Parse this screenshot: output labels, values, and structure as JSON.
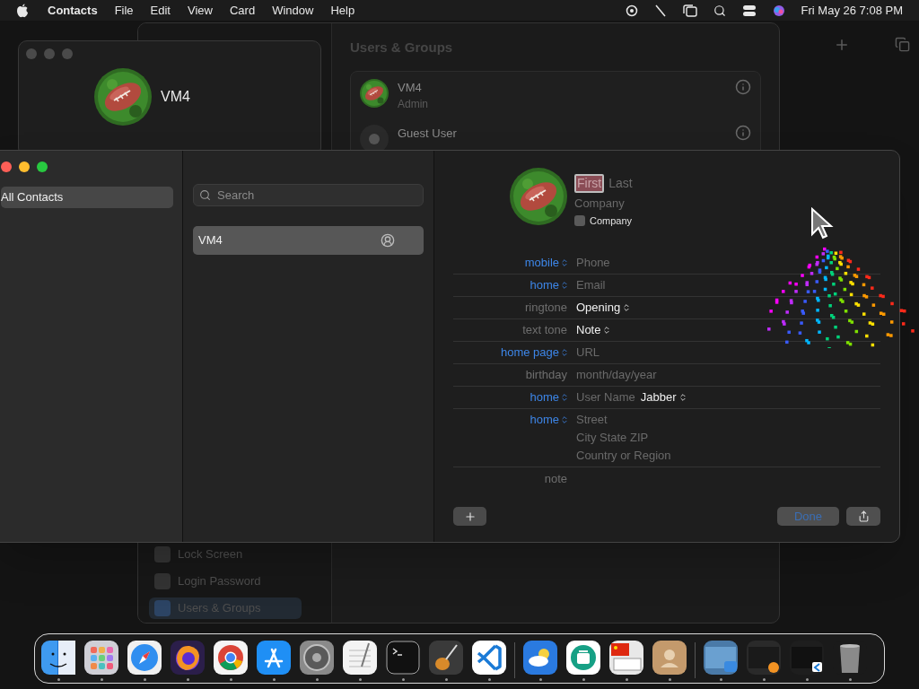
{
  "menu_bar": {
    "app_name": "Contacts",
    "menus": [
      "File",
      "Edit",
      "View",
      "Card",
      "Window",
      "Help"
    ],
    "clock": "Fri May 26 7:08 PM"
  },
  "user_window": {
    "name": "VM4"
  },
  "settings_window": {
    "title": "Users & Groups",
    "users": [
      {
        "name": "VM4",
        "role": "Admin",
        "kind": "avatar"
      },
      {
        "name": "Guest User",
        "kind": "guest"
      }
    ],
    "sidebar": [
      {
        "label": "Lock Screen",
        "selected": false
      },
      {
        "label": "Login Password",
        "selected": false
      },
      {
        "label": "Users & Groups",
        "selected": true
      }
    ]
  },
  "contacts_window": {
    "groups": [
      {
        "label": "All Contacts",
        "selected": true
      }
    ],
    "search": {
      "placeholder": "Search"
    },
    "contacts": [
      {
        "name": "VM4",
        "selected": true
      }
    ],
    "card": {
      "first": {
        "placeholder": "First",
        "selected": true
      },
      "last": {
        "placeholder": "Last"
      },
      "company": {
        "placeholder": "Company"
      },
      "company_checkbox": {
        "label": "Company",
        "checked": false
      },
      "fields": [
        {
          "label": "mobile",
          "kind": "popup",
          "values": [
            {
              "text": "Phone",
              "kind": "placeholder"
            }
          ]
        },
        {
          "label": "home",
          "kind": "popup",
          "values": [
            {
              "text": "Email",
              "kind": "placeholder"
            }
          ]
        },
        {
          "label": "ringtone",
          "kind": "plain",
          "values": [
            {
              "text": "Opening",
              "kind": "popup"
            }
          ]
        },
        {
          "label": "text tone",
          "kind": "plain",
          "values": [
            {
              "text": "Note",
              "kind": "popup"
            }
          ]
        },
        {
          "label": "home page",
          "kind": "popup",
          "values": [
            {
              "text": "URL",
              "kind": "placeholder"
            }
          ]
        },
        {
          "label": "birthday",
          "kind": "plain",
          "values": [
            {
              "text": "month/day/year",
              "kind": "placeholder"
            }
          ]
        },
        {
          "label": "home",
          "kind": "popup",
          "values": [
            {
              "text": "User Name",
              "kind": "placeholder"
            },
            {
              "text": "Jabber",
              "kind": "popup"
            }
          ]
        },
        {
          "label": "home",
          "kind": "address",
          "values": [
            {
              "text": "Street",
              "kind": "placeholder"
            },
            {
              "text": "City State ZIP",
              "kind": "placeholder"
            },
            {
              "text": "Country or Region",
              "kind": "placeholder"
            }
          ]
        },
        {
          "label": "note",
          "kind": "plain"
        }
      ],
      "done": {
        "label": "Done",
        "disabled": true
      }
    }
  }
}
